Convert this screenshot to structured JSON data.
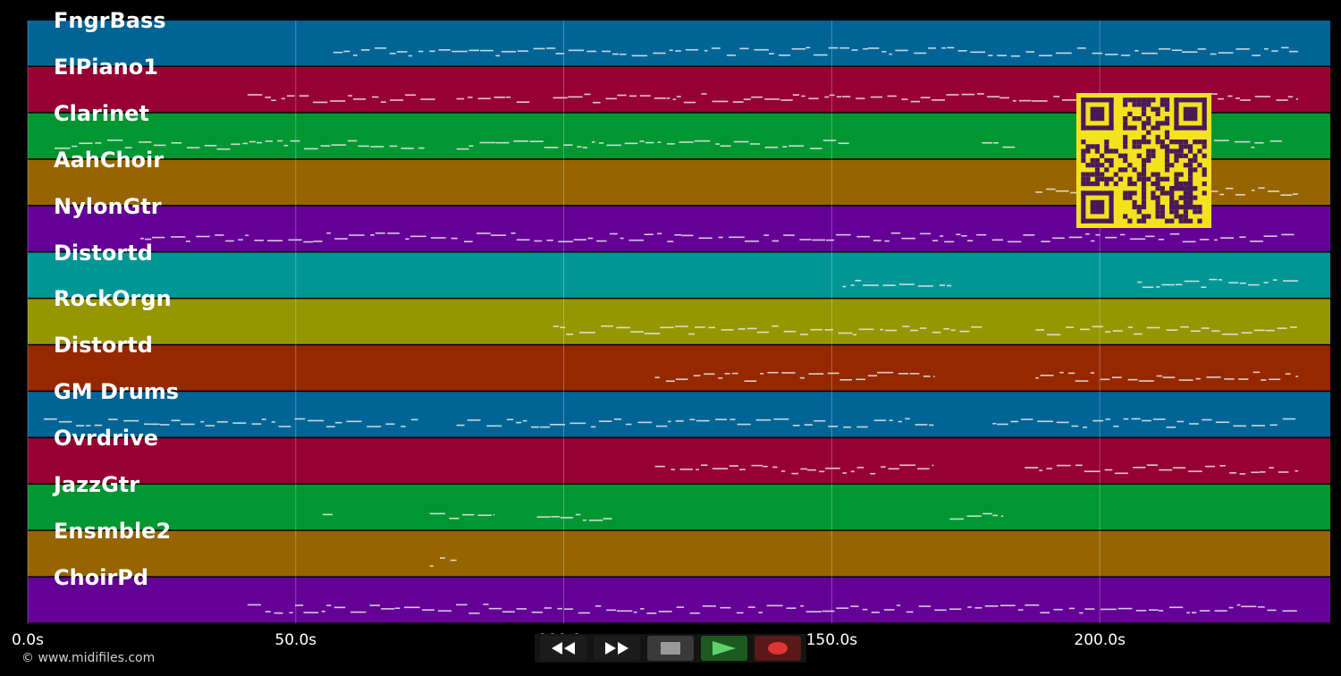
{
  "tracks": [
    {
      "label": "FngrBass",
      "color": "#006496"
    },
    {
      "label": "ElPiano1",
      "color": "#960032"
    },
    {
      "label": "Clarinet",
      "color": "#009632"
    },
    {
      "label": "AahChoir",
      "color": "#966400"
    },
    {
      "label": "NylonGtr",
      "color": "#640096"
    },
    {
      "label": "Distortd",
      "color": "#009696"
    },
    {
      "label": "RockOrgn",
      "color": "#969600"
    },
    {
      "label": "Distortd",
      "color": "#962800"
    },
    {
      "label": "GM Drums",
      "color": "#006496"
    },
    {
      "label": "Ovrdrive",
      "color": "#960032"
    },
    {
      "label": "JazzGtr",
      "color": "#009632"
    },
    {
      "label": "Ensmble2",
      "color": "#966400"
    },
    {
      "label": "ChoirPd",
      "color": "#640096"
    }
  ],
  "axis": {
    "ticks": [
      {
        "value": 0,
        "label": "0.0s"
      },
      {
        "value": 50,
        "label": "50.0s"
      },
      {
        "value": 100,
        "label": "100.0s"
      },
      {
        "value": 150,
        "label": "150.0s"
      },
      {
        "value": 200,
        "label": "200.0s"
      }
    ],
    "max_seconds": 243
  },
  "note_spans": [
    [
      [
        57,
        237
      ]
    ],
    [
      [
        41,
        76
      ],
      [
        80,
        94
      ],
      [
        98,
        237
      ]
    ],
    [
      [
        5,
        74
      ],
      [
        80,
        154
      ],
      [
        178,
        185
      ],
      [
        200,
        234
      ]
    ],
    [
      [
        188,
        237
      ]
    ],
    [
      [
        21,
        237
      ]
    ],
    [
      [
        152,
        173
      ],
      [
        207,
        237
      ]
    ],
    [
      [
        98,
        178
      ],
      [
        188,
        237
      ]
    ],
    [
      [
        117,
        169
      ],
      [
        188,
        237
      ]
    ],
    [
      [
        3,
        73
      ],
      [
        80,
        169
      ],
      [
        180,
        237
      ]
    ],
    [
      [
        117,
        169
      ],
      [
        186,
        237
      ]
    ],
    [
      [
        55,
        57
      ],
      [
        75,
        87
      ],
      [
        95,
        109
      ],
      [
        172,
        182
      ]
    ],
    [
      [
        75,
        80
      ]
    ],
    [
      [
        41,
        237
      ]
    ]
  ],
  "transport": {
    "rewind_icon": "rewind-icon",
    "forward_icon": "fast-forward-icon",
    "stop_icon": "stop-icon",
    "play_icon": "play-icon",
    "record_icon": "record-icon"
  },
  "qr_code": "qr-code-icon",
  "copyright": "© www.midifiles.com"
}
